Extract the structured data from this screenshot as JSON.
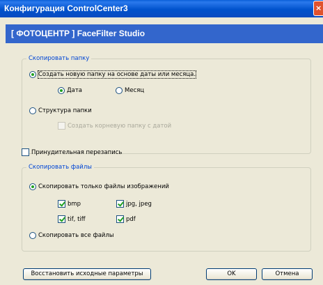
{
  "window": {
    "title": "Конфигурация ControlCenter3",
    "close_icon": "close-icon"
  },
  "header": {
    "text": "[ ФОТОЦЕНТР ]   FaceFilter Studio"
  },
  "copy_folder": {
    "legend": "Скопировать папку",
    "new_folder_label": "Создать новую папку на основе даты или месяца.",
    "date_label": "Дата",
    "month_label": "Месяц",
    "structure_label": "Структура папки",
    "root_folder_label": "Создать корневую папку с датой"
  },
  "overwrite_label": "Принудительная перезапись",
  "copy_files": {
    "legend": "Скопировать файлы",
    "images_only_label": "Скопировать только файлы изображений",
    "bmp": "bmp",
    "jpg": "jpg, jpeg",
    "tif": "tif, tiff",
    "pdf": "pdf",
    "all_files_label": "Скопировать все файлы"
  },
  "buttons": {
    "reset": "Восстановить исходные параметры",
    "ok": "OK",
    "cancel": "Отмена"
  },
  "colors": {
    "title_bar": "#0052cc",
    "header": "#3366cc",
    "legend": "#0046d5",
    "check": "#21a121"
  }
}
